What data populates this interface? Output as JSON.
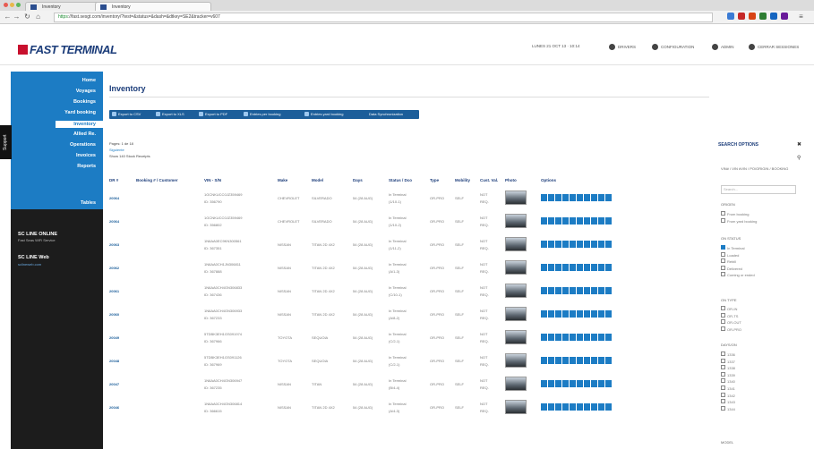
{
  "browser": {
    "tabs": [
      {
        "label": "Inventory"
      },
      {
        "label": "Inventory"
      }
    ],
    "url_scheme": "https",
    "url_rest": "://fast.sesgt.com/inventory/?test=&status=&dash=&dtkey=SE2&tracker=v607"
  },
  "app": {
    "logo": "FAST TERMINAL",
    "topnav": {
      "date": "LUNES 21 OCT 13 · 10:14",
      "item1": "DRIVERS",
      "item2": "CONFIGURATION",
      "item3": "ADMIN",
      "item4": "CERRAR SESSIONES"
    }
  },
  "sidebar": {
    "items": [
      {
        "label": "Home"
      },
      {
        "label": "Voyages"
      },
      {
        "label": "Bookings"
      },
      {
        "label": "Yard booking"
      },
      {
        "label": "Inventory"
      },
      {
        "label": "Allied Re."
      },
      {
        "label": "Operations"
      },
      {
        "label": "Invoices"
      },
      {
        "label": "Reports"
      },
      {
        "label": "Tables"
      }
    ],
    "support": "Support",
    "sc1": "SC LINE ONLINE",
    "sc1_sub": "Fast Seas WiFi Service",
    "sc2": "SC LINE Web",
    "sc2_sub": "sclineweb.com"
  },
  "main": {
    "title": "Inventory",
    "buttons": [
      {
        "label": "Export to CSV"
      },
      {
        "label": "Export to XLS"
      },
      {
        "label": "Export to PDF"
      },
      {
        "label": "Entries per booking"
      },
      {
        "label": "Entries yard booking"
      },
      {
        "label": "Data Synchronization"
      }
    ],
    "pager_page": "Pages: 1 de 18",
    "pager_link": "Siguiente",
    "pager_info": "Show 140 Stock Receipts"
  },
  "table": {
    "headers": [
      "DR #",
      "Booking # / Customer",
      "VIN - S/N",
      "Make",
      "Model",
      "Days",
      "Status / Dco",
      "Type",
      "Mobility",
      "Cust. Val.",
      "Photo",
      "Options"
    ],
    "rows": [
      {
        "dr": "20064",
        "vin": "1GCNKUCC0JZ359469",
        "vin2": "ID: 356790",
        "make": "CHEVROLET",
        "model": "SILVERADO",
        "days": "54 (28 AUG)",
        "status": "In Terminal",
        "status2": "(1/10-1)",
        "type": "OR-PRO",
        "mob": "SELF",
        "val": "NOT",
        "val2": "REQ."
      },
      {
        "dr": "20064",
        "vin": "1GCNKUCC0JZ359469",
        "vin2": "ID: 356802",
        "make": "CHEVROLET",
        "model": "SILVERADO",
        "days": "54 (28 AUG)",
        "status": "In Terminal",
        "status2": "(1/10-2)",
        "type": "OR-PRO",
        "mob": "SELF",
        "val": "NOT",
        "val2": "REQ."
      },
      {
        "dr": "20063",
        "vin": "1N6AA0EC9KN300561",
        "vin2": "ID: 367351",
        "make": "NISSAN",
        "model": "TITAN 2D 4X2",
        "days": "54 (28 AUG)",
        "status": "In Terminal",
        "status2": "(1/11-2)",
        "type": "OR-PRO",
        "mob": "SELF",
        "val": "NOT",
        "val2": "REQ."
      },
      {
        "dr": "20062",
        "vin": "1N6AA0CH1JN306811",
        "vin2": "ID: 367888",
        "make": "NISSAN",
        "model": "TITAN 2D 4X2",
        "days": "54 (28 AUG)",
        "status": "In Terminal",
        "status2": "(A/1-3)",
        "type": "OR-PRO",
        "mob": "SELF",
        "val": "NOT",
        "val2": "REQ."
      },
      {
        "dr": "20061",
        "vin": "1N6AA0CH4GN306833",
        "vin2": "ID: 367436",
        "make": "NISSAN",
        "model": "TITAN 2D 4X2",
        "days": "54 (28 AUG)",
        "status": "In Terminal",
        "status2": "(C/10-1)",
        "type": "OR-PRO",
        "mob": "SELF",
        "val": "NOT",
        "val2": "REQ."
      },
      {
        "dr": "20060",
        "vin": "1N6AA0CH4GN306933",
        "vin2": "ID: 367233",
        "make": "NISSAN",
        "model": "TITAN 2D 4X2",
        "days": "54 (28 AUG)",
        "status": "In Terminal",
        "status2": "(A/8-2)",
        "type": "OR-PRO",
        "mob": "SELF",
        "val": "NOT",
        "val2": "REQ."
      },
      {
        "dr": "20049",
        "vin": "5TDBK3EH1GS091974",
        "vin2": "ID: 367966",
        "make": "TOYOTA",
        "model": "SEQUOIA",
        "days": "54 (28 AUG)",
        "status": "In Terminal",
        "status2": "(C/2-1)",
        "type": "OR-PRO",
        "mob": "SELF",
        "val": "NOT",
        "val2": "REQ."
      },
      {
        "dr": "20048",
        "vin": "5TDBK3EH1GS091126",
        "vin2": "ID: 367969",
        "make": "TOYOTA",
        "model": "SEQUOIA",
        "days": "54 (28 AUG)",
        "status": "In Terminal",
        "status2": "(C/2-1)",
        "type": "OR-PRO",
        "mob": "SELF",
        "val": "NOT",
        "val2": "REQ."
      },
      {
        "dr": "20047",
        "vin": "1N6AA0CH4GN306947",
        "vin2": "ID: 367235",
        "make": "NISSAN",
        "model": "TITAN",
        "days": "54 (28 AUG)",
        "status": "In Terminal",
        "status2": "(B/4-4)",
        "type": "OR-PRO",
        "mob": "SELF",
        "val": "NOT",
        "val2": "REQ."
      },
      {
        "dr": "20046",
        "vin": "1N6AA0CH4GN306814",
        "vin2": "ID: 366615",
        "make": "NISSAN",
        "model": "TITAN 2D 4X2",
        "days": "54 (28 AUG)",
        "status": "In Terminal",
        "status2": "(A/4-3)",
        "type": "OR-PRO",
        "mob": "SELF",
        "val": "NOT",
        "val2": "REQ."
      }
    ]
  },
  "search": {
    "title": "SEARCH OPTIONS",
    "vin_label": "VIN# / VIN #VIN / PO/ORIGIN / BOOKING",
    "vin_placeholder": "Search...",
    "origen_label": "ORIGEN",
    "origen_opts": [
      "From booking",
      "From yard booking"
    ],
    "status_label": "ON STATUS",
    "status_opts": [
      "In Terminal",
      "Loaded",
      "Rebill",
      "Delivered",
      "Coming or ended"
    ],
    "type_label": "ON TYPE",
    "type_opts": [
      "OR-IN",
      "OR-TS",
      "OR-OUT",
      "OR-PRO"
    ],
    "days_label": "DAYS/ON",
    "days_opts": [
      "1336",
      "1337",
      "1338",
      "1339",
      "1340",
      "1341",
      "1342",
      "1343",
      "1344"
    ],
    "models_label": "MODEL"
  }
}
